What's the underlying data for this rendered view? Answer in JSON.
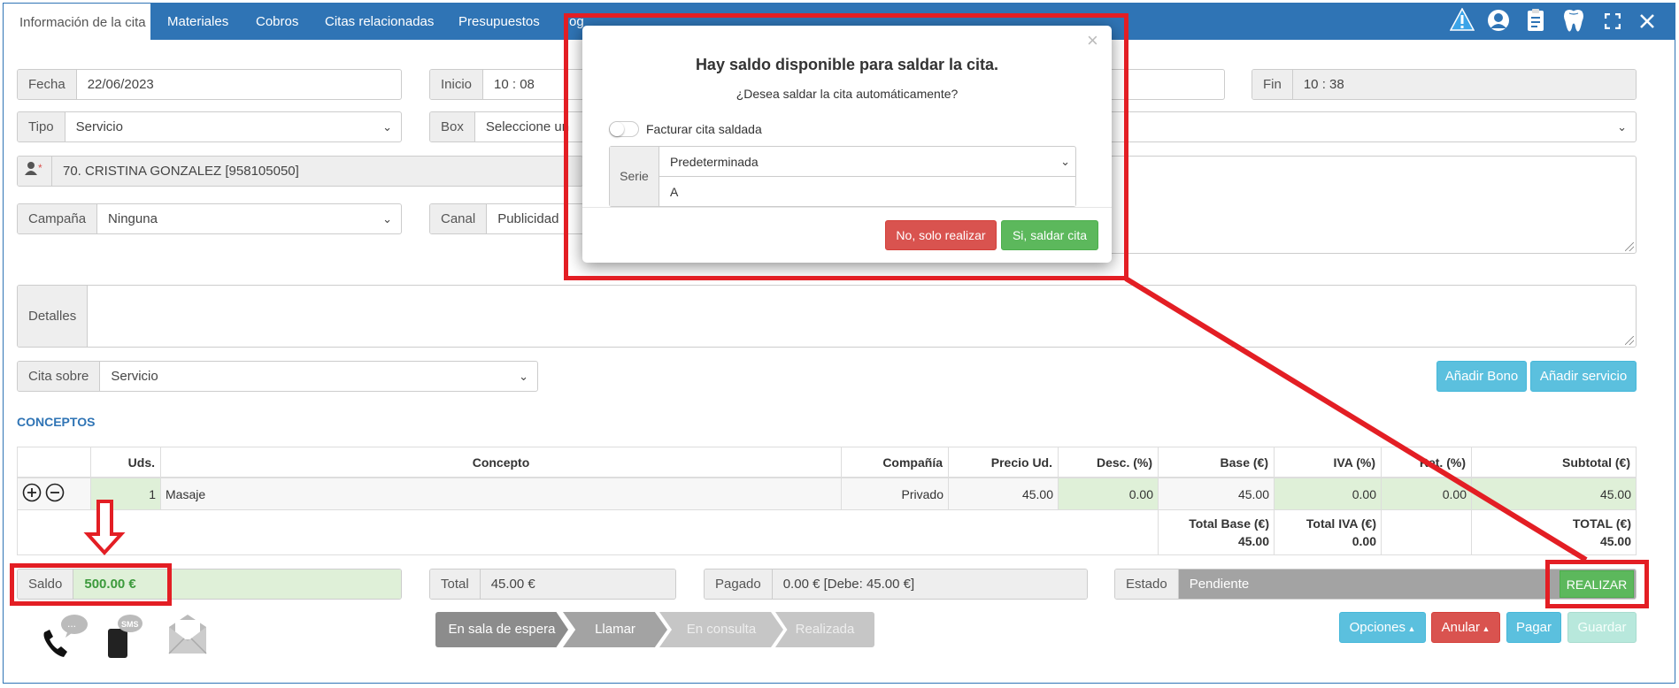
{
  "tabs": [
    "Información de la cita",
    "Materiales",
    "Cobros",
    "Citas relacionadas",
    "Presupuestos",
    "og"
  ],
  "toolbar_icons": [
    "warning-icon",
    "user-icon",
    "clipboard-icon",
    "tooth-icon",
    "fullscreen-icon",
    "close-icon"
  ],
  "form": {
    "fecha_label": "Fecha",
    "fecha_value": "22/06/2023",
    "inicio_label": "Inicio",
    "inicio_value": "10 : 08",
    "fin_label": "Fin",
    "fin_value": "10 : 38",
    "tipo_label": "Tipo",
    "tipo_value": "Servicio",
    "box_label": "Box",
    "box_value": "Seleccione un",
    "paciente_value": "70. CRISTINA GONZALEZ [958105050]",
    "campana_label": "Campaña",
    "campana_value": "Ninguna",
    "canal_label": "Canal",
    "canal_value": "Publicidad",
    "detalles_label": "Detalles",
    "cita_sobre_label": "Cita sobre",
    "cita_sobre_value": "Servicio"
  },
  "buttons": {
    "anadir_bono": "Añadir Bono",
    "anadir_servicio": "Añadir servicio",
    "opciones": "Opciones",
    "anular": "Anular",
    "pagar": "Pagar",
    "guardar": "Guardar",
    "realizar": "REALIZAR"
  },
  "conceptos": {
    "title": "CONCEPTOS",
    "headers": [
      "",
      "Uds.",
      "Concepto",
      "Compañía",
      "Precio Ud.",
      "Desc. (%)",
      "Base (€)",
      "IVA (%)",
      "Ret. (%)",
      "Subtotal (€)"
    ],
    "row": {
      "uds": "1",
      "concepto": "Masaje",
      "compania": "Privado",
      "precio": "45.00",
      "desc": "0.00",
      "base": "45.00",
      "iva": "0.00",
      "ret": "0.00",
      "subtotal": "45.00"
    },
    "totals": {
      "base_label": "Total Base (€)",
      "base_value": "45.00",
      "iva_label": "Total IVA (€)",
      "iva_value": "0.00",
      "total_label": "TOTAL (€)",
      "total_value": "45.00"
    }
  },
  "summary": {
    "saldo_label": "Saldo",
    "saldo_value": "500.00 €",
    "total_label": "Total",
    "total_value": "45.00 €",
    "pagado_label": "Pagado",
    "pagado_value": "0.00 € [Debe: 45.00 €]",
    "estado_label": "Estado",
    "estado_value": "Pendiente"
  },
  "steps": [
    "En sala de espera",
    "Llamar",
    "En consulta",
    "Realizada"
  ],
  "contact_icons": [
    "phone-icon",
    "sms-icon",
    "email-icon"
  ],
  "modal": {
    "title": "Hay saldo disponible para saldar la cita.",
    "subtitle": "¿Desea saldar la cita automáticamente?",
    "toggle_label": "Facturar cita saldada",
    "serie_label": "Serie",
    "serie_value": "Predeterminada",
    "serie_code": "A",
    "no_button": "No, solo realizar",
    "yes_button": "Si, saldar cita",
    "close_symbol": "×"
  },
  "colors": {
    "primary": "#2f74b5",
    "highlight": "#e31e24",
    "success": "#5cb85c",
    "danger": "#d9534f",
    "info": "#5bc0de"
  }
}
